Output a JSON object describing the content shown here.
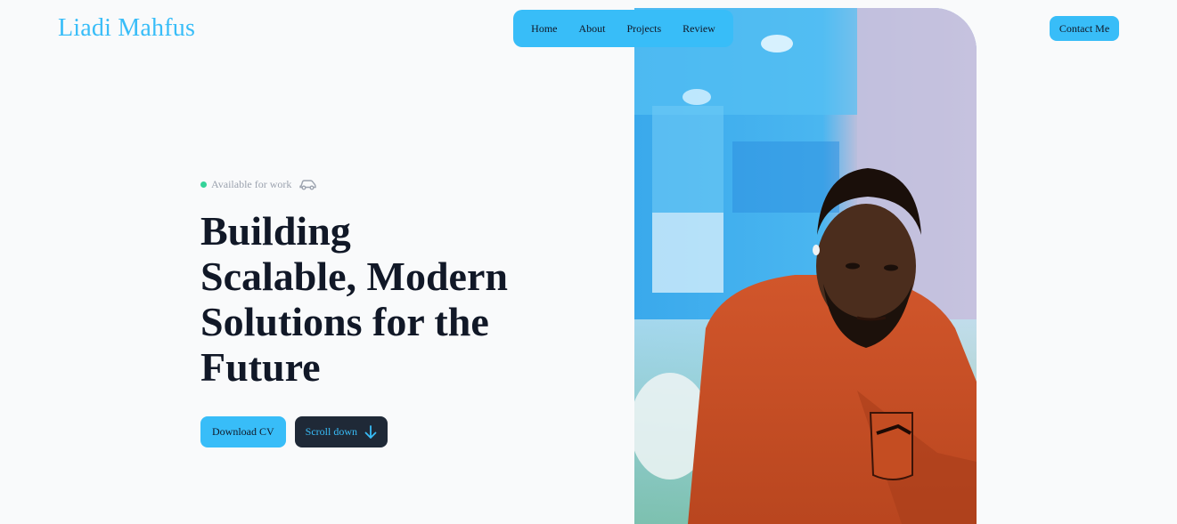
{
  "header": {
    "logo": "Liadi Mahfus",
    "nav": [
      "Home",
      "About",
      "Projects",
      "Review"
    ],
    "contact_label": "Contact Me"
  },
  "hero": {
    "status": "Available for work",
    "headline_lines": [
      "Building",
      "Scalable, Modern",
      "Solutions for the",
      "Future"
    ],
    "download_label": "Download CV",
    "scroll_label": "Scroll down"
  },
  "colors": {
    "accent": "#38bdf8",
    "status_dot": "#34d399",
    "dark_button": "#1f2937",
    "heading": "#111827"
  },
  "icons": {
    "status_trailing": "car-icon",
    "scroll": "arrow-down-icon"
  }
}
